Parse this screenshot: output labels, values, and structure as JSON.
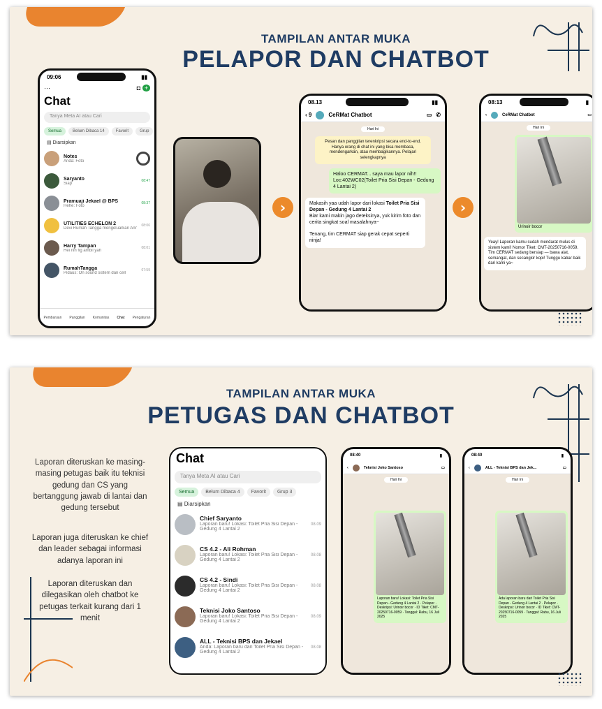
{
  "slide1": {
    "kicker": "TAMPILAN ANTAR MUKA",
    "title": "PELAPOR DAN CHATBOT",
    "chat_list_phone": {
      "time": "09:06",
      "header": "Chat",
      "search_placeholder": "Tanya Meta AI atau Cari",
      "chips": [
        "Semua",
        "Belum Dibaca 14",
        "Favorit",
        "Grup"
      ],
      "archived": "Diarsipkan",
      "rows": [
        {
          "name": "Notes",
          "preview": "Anda: Foto",
          "time": ""
        },
        {
          "name": "Saryanto",
          "preview": "Siap",
          "time": "08:47"
        },
        {
          "name": "Pramuaji Jekael @ BPS",
          "preview": "Hehe: Foto",
          "time": "08:37"
        },
        {
          "name": "UTILITIES ECHELON 2",
          "preview": "Devi Rumah Tangga mengeluarkan Anni Saleha",
          "time": "08:06"
        },
        {
          "name": "Harry Tampan",
          "preview": "Hei nih fig ambil yah",
          "time": "08:01"
        },
        {
          "name": "RumahTangga",
          "preview": "Pidaus: On sound sistem dan cell",
          "time": "07:59"
        }
      ],
      "tabs": [
        "Pembaruan",
        "Panggilan",
        "Komunitas",
        "Chat",
        "Pengaturan"
      ]
    },
    "chatbot_phone": {
      "time": "08.13",
      "back": "9",
      "contact": "CeRMat Chatbot",
      "date": "Hari Ini",
      "system": "Pesan dan panggilan terenkripsi secara end-to-end. Hanya orang di chat ini yang bisa membaca, mendengarkan, atau membagikannya. Pelajari selengkapnya",
      "out_msg": "Haloo CERMAT... saya mau lapor nih!! Loc:402WC02(Toilet Pria Sisi Depan - Gedung 4 Lantai 2)",
      "out_time": "08.13",
      "in_msg_1": "Makasih yaa udah lapor dari lokasi",
      "in_msg_bold": "Toilet Pria Sisi Depan - Gedung 4 Lantai 2",
      "in_msg_2": "Biar kami makin jago deteksinya, yuk kirim foto dan cerita singkat soal masalahnya~",
      "in_msg_3": "Tenang, tim CERMAT siap gerak cepat seperti ninja!",
      "in_time": "08.13"
    },
    "chatbot_phone_2": {
      "time": "08:13",
      "contact": "CeRMat Chatbot",
      "date": "Hari Ini",
      "caption": "Urinoir bocor",
      "reply": "Yeay! Laporan kamu sudah mendarat mulus di sistem kami! Nomor Tiket: CMT-20250716-0059. Tim CERMAT sedang bersiap — bawa alat, semangat, dan secangkir kopi! Tunggu kabar baik dari kami ya~"
    }
  },
  "slide2": {
    "kicker": "TAMPILAN ANTAR MUKA",
    "title": "PETUGAS DAN CHATBOT",
    "desc": [
      "Laporan diteruskan ke masing-masing petugas baik itu teknisi gedung dan CS yang bertanggung jawab di lantai dan gedung tersebut",
      "Laporan juga diteruskan ke chief dan leader sebagai informasi adanya laporan ini",
      "Laporan diteruskan dan dilegasikan oleh chatbot ke petugas terkait kurang dari 1 menit"
    ],
    "chat_list": {
      "header": "Chat",
      "search_placeholder": "Tanya Meta AI atau Cari",
      "chips": [
        "Semua",
        "Belum Dibaca 4",
        "Favorit",
        "Grup 3"
      ],
      "archived": "Diarsipkan",
      "rows": [
        {
          "name": "Chief Saryanto",
          "preview": "Laporan baru! Lokasi: Toilet Pria Sisi Depan - Gedung 4 Lantai 2",
          "time": "08.09"
        },
        {
          "name": "CS 4.2 - Ali Rohman",
          "preview": "Laporan baru! Lokasi: Toilet Pria Sisi Depan - Gedung 4 Lantai 2",
          "time": "08.08"
        },
        {
          "name": "CS 4.2 - Sindi",
          "preview": "Laporan baru! Lokasi: Toilet Pria Sisi Depan - Gedung 4 Lantai 2",
          "time": "08.08"
        },
        {
          "name": "Teknisi Joko Santoso",
          "preview": "Laporan baru! Lokasi: Toilet Pria Sisi Depan - Gedung 4 Lantai 2",
          "time": "08.09"
        },
        {
          "name": "ALL - Teknisi BPS dan Jekael",
          "preview": "Anda: Laporan baru dari Toilet Pria Sisi Depan - Gedung 4 Lantai 2",
          "time": "08.08"
        }
      ]
    },
    "officer_phone_1": {
      "time": "08:40",
      "contact": "Teknisi Joko Santoso",
      "date": "Hari Ini",
      "report": "Laporan baru! Lokasi: Toilet Pria Sisi Depan - Gedung 4 Lantai 2 · Pelapor · Deskripsi: Urinoir bocor · ID Tiket: CMT-20250716-0059 · Tanggal: Rabu, 16 Juli 2025"
    },
    "officer_phone_2": {
      "time": "08:40",
      "contact": "ALL - Teknisi BPS dan Jek...",
      "date": "Hari Ini",
      "report": "Ada laporan baru dari Toilet Pria Sisi Depan - Gedung 4 Lantai 2 · Pelapor · Deskripsi: Urinoir bocor · ID Tiket: CMT-20250716-0059 · Tanggal: Rabu, 16 Juli 2025"
    }
  }
}
